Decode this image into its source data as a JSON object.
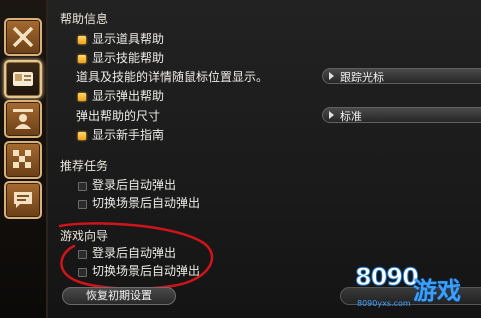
{
  "sidebar": {
    "icons": [
      {
        "name": "combat-icon"
      },
      {
        "name": "card-icon"
      },
      {
        "name": "character-icon"
      },
      {
        "name": "checker-icon"
      },
      {
        "name": "chat-icon"
      }
    ]
  },
  "help_info": {
    "title": "帮助信息",
    "show_item_help": "显示道具帮助",
    "show_skill_help": "显示技能帮助",
    "detail_follow_text": "道具及技能的详情随鼠标位置显示。",
    "follow_dropdown_value": "跟踪光标",
    "show_popup_help": "显示弹出帮助",
    "popup_size_text": "弹出帮助的尺寸",
    "size_dropdown_value": "标准",
    "show_newbie_guide": "显示新手指南"
  },
  "recommended_tasks": {
    "title": "推荐任务",
    "popup_after_login": "登录后自动弹出",
    "popup_on_scene_switch": "切换场景后自动弹出"
  },
  "game_guide": {
    "title": "游戏向导",
    "popup_after_login": "登录后自动弹出",
    "popup_on_scene_switch": "切换场景后自动弹出"
  },
  "buttons": {
    "reset_label": "恢复初期设置"
  },
  "watermark": {
    "number": "8090",
    "brand": "游戏",
    "url": "8090yxs.com"
  },
  "colors": {
    "checked": "#f2a21a",
    "annotation_ring": "#d0141b",
    "logo_blue": "#3aa0ff"
  }
}
